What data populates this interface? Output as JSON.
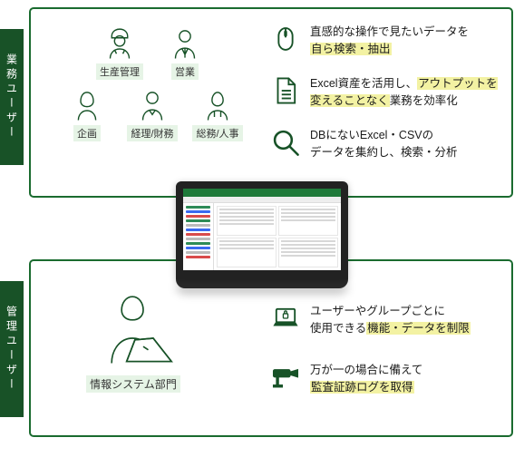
{
  "tabs": {
    "top": "業務ユーザー",
    "bottom": "管理ユーザー"
  },
  "roles": {
    "r1": "生産管理",
    "r2": "営業",
    "r3": "企画",
    "r4": "経理/財務",
    "r5": "総務/人事"
  },
  "feat1": {
    "a1": "直感的な操作で見たいデータを",
    "a2": "自ら検索・抽出",
    "b1": "Excel資産を活用し、",
    "b2": "アウトプットを変えることなく",
    "b2b": "業務を効率化",
    "c1": "DBにないExcel・CSVの",
    "c2": "データを集約し、検索・分析"
  },
  "admin": {
    "label": "情報システム部門"
  },
  "feat2": {
    "a1": "ユーザーやグループごとに",
    "a2a": "使用できる",
    "a2b": "機能・データを制限",
    "b1": "万が一の場合に備えて",
    "b2": "監査証跡ログを取得"
  }
}
